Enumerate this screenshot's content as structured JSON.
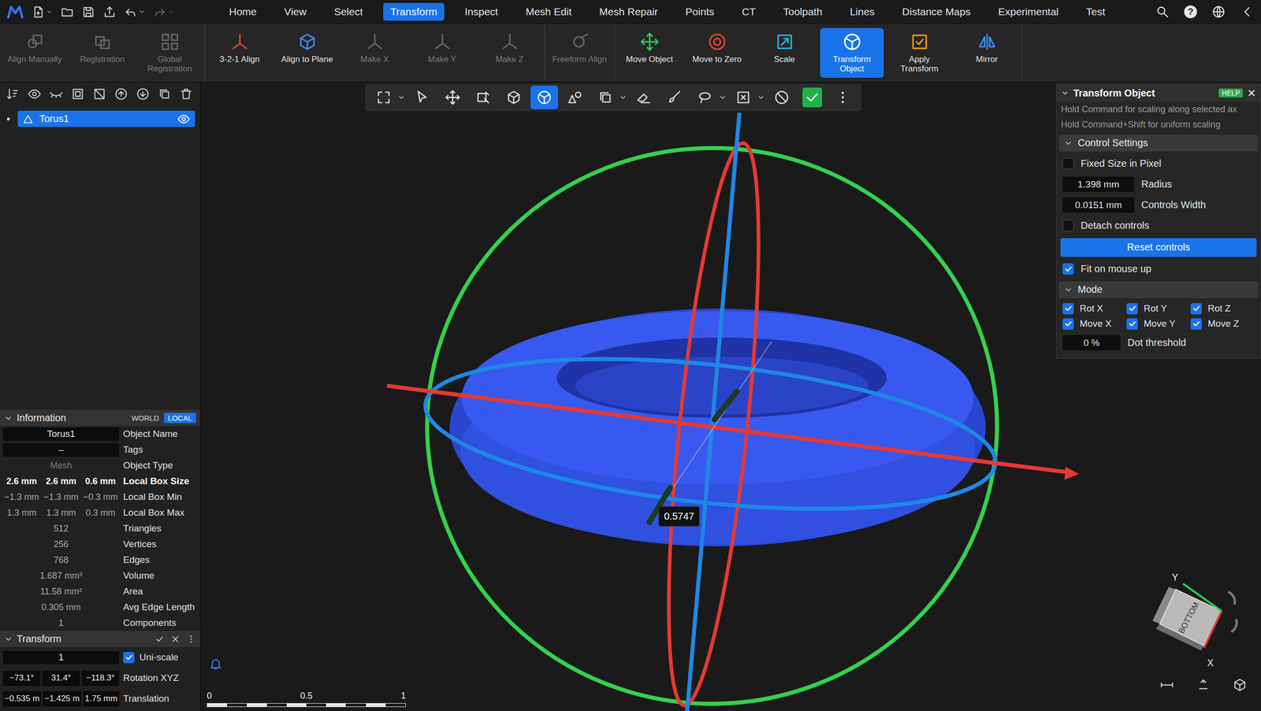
{
  "menubar": {
    "quick_actions": [
      {
        "dropdown": true,
        "disabled": false
      },
      {
        "dropdown": false,
        "disabled": false
      },
      {
        "dropdown": false,
        "disabled": false
      },
      {
        "dropdown": false,
        "disabled": false
      },
      {
        "dropdown": true,
        "disabled": false
      },
      {
        "dropdown": true,
        "disabled": true
      }
    ],
    "tabs": [
      {
        "label": "Home",
        "selected": false
      },
      {
        "label": "View",
        "selected": false
      },
      {
        "label": "Select",
        "selected": false
      },
      {
        "label": "Transform",
        "selected": true
      },
      {
        "label": "Inspect",
        "selected": false
      },
      {
        "label": "Mesh Edit",
        "selected": false
      },
      {
        "label": "Mesh Repair",
        "selected": false
      },
      {
        "label": "Points",
        "selected": false
      },
      {
        "label": "CT",
        "selected": false
      },
      {
        "label": "Toolpath",
        "selected": false
      },
      {
        "label": "Lines",
        "selected": false
      },
      {
        "label": "Distance Maps",
        "selected": false
      },
      {
        "label": "Experimental",
        "selected": false
      },
      {
        "label": "Test",
        "selected": false
      }
    ],
    "help_glyph": "?"
  },
  "ribbon": {
    "groups": [
      [
        {
          "label": "Align Manually",
          "disabled": true,
          "selected": false
        },
        {
          "label": "Registration",
          "disabled": true,
          "selected": false
        },
        {
          "label": "Global Registration",
          "disabled": true,
          "selected": false
        }
      ],
      [
        {
          "label": "3-2-1 Align",
          "disabled": false,
          "selected": false
        },
        {
          "label": "Align to Plane",
          "disabled": false,
          "selected": false
        },
        {
          "label": "Make X",
          "disabled": true,
          "selected": false
        },
        {
          "label": "Make Y",
          "disabled": true,
          "selected": false
        },
        {
          "label": "Make Z",
          "disabled": true,
          "selected": false
        }
      ],
      [
        {
          "label": "Freeform Align",
          "disabled": true,
          "selected": false
        }
      ],
      [
        {
          "label": "Move Object",
          "disabled": false,
          "selected": false
        },
        {
          "label": "Move to Zero",
          "disabled": false,
          "selected": false
        },
        {
          "label": "Scale",
          "disabled": false,
          "selected": false
        },
        {
          "label": "Transform Object",
          "disabled": false,
          "selected": true
        },
        {
          "label": "Apply Transform",
          "disabled": false,
          "selected": false
        },
        {
          "label": "Mirror",
          "disabled": false,
          "selected": false
        }
      ]
    ]
  },
  "scene": {
    "items": [
      {
        "name": "Torus1",
        "selected": true,
        "visible": true
      }
    ]
  },
  "information": {
    "title": "Information",
    "expanded": true,
    "frames": [
      {
        "label": "WORLD",
        "selected": false
      },
      {
        "label": "LOCAL",
        "selected": true
      }
    ],
    "rows": [
      {
        "kind": "field",
        "values": [
          "Torus1"
        ],
        "label": "Object Name",
        "emphasis": false,
        "disabled": false
      },
      {
        "kind": "field",
        "values": [
          "–"
        ],
        "label": "Tags",
        "emphasis": false,
        "disabled": false
      },
      {
        "kind": "text",
        "values": [
          "Mesh"
        ],
        "label": "Object Type",
        "emphasis": false,
        "disabled": true
      },
      {
        "kind": "text",
        "values": [
          "2.6 mm",
          "2.6 mm",
          "0.6 mm"
        ],
        "label": "Local Box Size",
        "emphasis": true,
        "disabled": false
      },
      {
        "kind": "text",
        "values": [
          "−1.3 mm",
          "−1.3 mm",
          "−0.3 mm"
        ],
        "label": "Local Box Min",
        "emphasis": false,
        "disabled": false
      },
      {
        "kind": "text",
        "values": [
          "1.3 mm",
          "1.3 mm",
          "0.3 mm"
        ],
        "label": "Local Box Max",
        "emphasis": false,
        "disabled": false
      },
      {
        "kind": "text",
        "values": [
          "512"
        ],
        "label": "Triangles",
        "emphasis": false,
        "disabled": false
      },
      {
        "kind": "text",
        "values": [
          "256"
        ],
        "label": "Vertices",
        "emphasis": false,
        "disabled": false
      },
      {
        "kind": "text",
        "values": [
          "768"
        ],
        "label": "Edges",
        "emphasis": false,
        "disabled": false
      },
      {
        "kind": "text",
        "values": [
          "1.687 mm³"
        ],
        "label": "Volume",
        "emphasis": false,
        "disabled": false
      },
      {
        "kind": "text",
        "values": [
          "11.58 mm²"
        ],
        "label": "Area",
        "emphasis": false,
        "disabled": false
      },
      {
        "kind": "text",
        "values": [
          "0.305 mm"
        ],
        "label": "Avg Edge Length",
        "emphasis": false,
        "disabled": false
      },
      {
        "kind": "text",
        "values": [
          "1"
        ],
        "label": "Components",
        "emphasis": false,
        "disabled": false
      }
    ]
  },
  "transform": {
    "title": "Transform",
    "expanded": true,
    "scale": {
      "value": "1",
      "label": "Uni-scale",
      "checked": true
    },
    "rows": [
      {
        "label": "Rotation XYZ",
        "values": [
          "−73.1°",
          "31.4°",
          "−118.3°"
        ]
      },
      {
        "label": "Translation",
        "values": [
          "−0.535 m",
          "−1.425 m",
          "1.75 mm"
        ]
      }
    ]
  },
  "viewport_toolbar": {
    "items": [
      {
        "selected": false,
        "on": false,
        "dropdown": true
      },
      {
        "selected": false,
        "on": false,
        "dropdown": false
      },
      {
        "selected": false,
        "on": false,
        "dropdown": false
      },
      {
        "selected": false,
        "on": false,
        "dropdown": false
      },
      {
        "selected": false,
        "on": false,
        "dropdown": false
      },
      {
        "selected": true,
        "on": false,
        "dropdown": false
      },
      {
        "selected": false,
        "on": false,
        "dropdown": false
      },
      {
        "selected": false,
        "on": false,
        "dropdown": true
      },
      {
        "selected": false,
        "on": false,
        "dropdown": false
      },
      {
        "selected": false,
        "on": false,
        "dropdown": false
      },
      {
        "selected": false,
        "on": false,
        "dropdown": true
      },
      {
        "selected": false,
        "on": false,
        "dropdown": true
      },
      {
        "selected": false,
        "on": false,
        "dropdown": false
      },
      {
        "selected": false,
        "on": true,
        "dropdown": false
      },
      {
        "selected": false,
        "on": false,
        "dropdown": false
      }
    ]
  },
  "transform_panel": {
    "title": "Transform Object",
    "help": "HELP",
    "hints": [
      "Hold Command for scaling along selected ax",
      "Hold Command+Shift for uniform scaling"
    ],
    "sections": [
      {
        "title": "Control Settings",
        "expanded": true,
        "controls": [
          {
            "kind": "checkbox",
            "label": "Fixed Size in Pixel",
            "checked": false
          },
          {
            "kind": "number",
            "value": "1.398 mm",
            "label": "Radius"
          },
          {
            "kind": "number",
            "value": "0.0151 mm",
            "label": "Controls Width"
          },
          {
            "kind": "checkbox",
            "label": "Detach controls",
            "checked": false
          },
          {
            "kind": "button",
            "label": "Reset controls"
          },
          {
            "kind": "checkbox",
            "label": "Fit on mouse up",
            "checked": true
          }
        ]
      },
      {
        "title": "Mode",
        "expanded": true,
        "controls": [
          {
            "kind": "checkgrid",
            "items": [
              {
                "label": "Rot X",
                "checked": true
              },
              {
                "label": "Rot Y",
                "checked": true
              },
              {
                "label": "Rot Z",
                "checked": true
              },
              {
                "label": "Move X",
                "checked": true
              },
              {
                "label": "Move Y",
                "checked": true
              },
              {
                "label": "Move Z",
                "checked": true
              }
            ]
          },
          {
            "kind": "number",
            "value": "0 %",
            "label": "Dot threshold"
          }
        ]
      }
    ]
  },
  "gizmo": {
    "tooltip": "0.5747"
  },
  "scale_bar": {
    "ticks": [
      "0",
      "0.5",
      "1"
    ]
  },
  "view_cube": {
    "face": "BOTTOM",
    "up_axis": "Y",
    "side_axis": "X"
  }
}
